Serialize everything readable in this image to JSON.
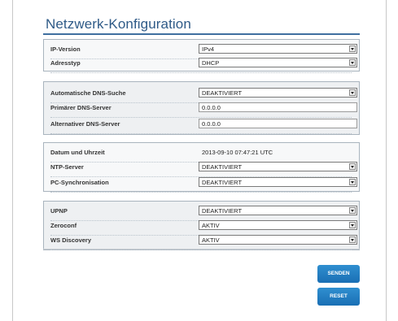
{
  "page": {
    "title": "Netzwerk-Konfiguration"
  },
  "ip_section": {
    "ip_version": {
      "label": "IP-Version",
      "value": "IPv4"
    },
    "address_type": {
      "label": "Adresstyp",
      "value": "DHCP"
    }
  },
  "dns_section": {
    "auto_dns": {
      "label": "Automatische DNS-Suche",
      "value": "DEAKTIVIERT"
    },
    "primary_dns": {
      "label": "Primärer DNS-Server",
      "value": "0.0.0.0"
    },
    "alternate_dns": {
      "label": "Alternativer DNS-Server",
      "value": "0.0.0.0"
    }
  },
  "time_section": {
    "datetime": {
      "label": "Datum und Uhrzeit",
      "value": "2013-09-10 07:47:21 UTC"
    },
    "ntp": {
      "label": "NTP-Server",
      "value": "DEAKTIVIERT"
    },
    "pc_sync": {
      "label": "PC-Synchronisation",
      "value": "DEAKTIVIERT"
    }
  },
  "discovery_section": {
    "upnp": {
      "label": "UPNP",
      "value": "DEAKTIVIERT"
    },
    "zeroconf": {
      "label": "Zeroconf",
      "value": "AKTIV"
    },
    "ws_discovery": {
      "label": "WS Discovery",
      "value": "AKTIV"
    }
  },
  "buttons": {
    "send": "SENDEN",
    "reset": "RESET"
  }
}
